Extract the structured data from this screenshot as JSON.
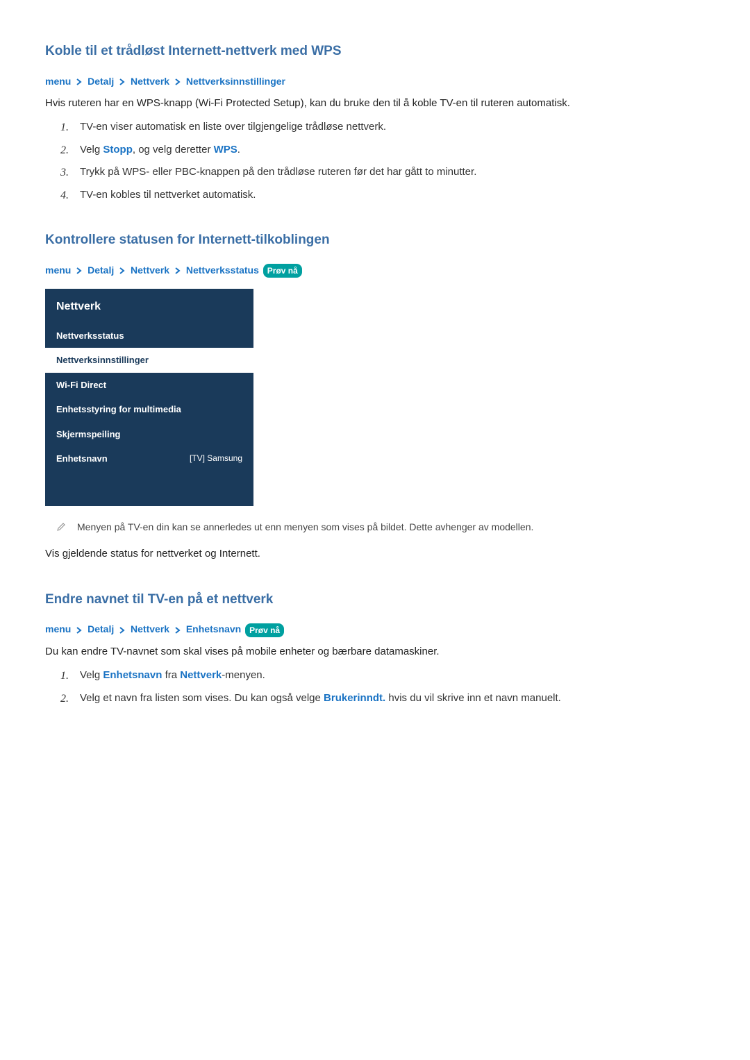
{
  "section1": {
    "heading": "Koble til et trådløst Internett-nettverk med WPS",
    "breadcrumb": [
      "menu",
      "Detalj",
      "Nettverk",
      "Nettverksinnstillinger"
    ],
    "intro": "Hvis ruteren har en WPS-knapp (Wi-Fi Protected Setup), kan du bruke den til å koble TV-en til ruteren automatisk.",
    "steps": {
      "s1": "TV-en viser automatisk en liste over tilgjengelige trådløse nettverk.",
      "s2_a": "Velg ",
      "s2_stop": "Stopp",
      "s2_b": ", og velg deretter ",
      "s2_wps": "WPS",
      "s2_c": ".",
      "s3": "Trykk på WPS- eller PBC-knappen på den trådløse ruteren før det har gått to minutter.",
      "s4": "TV-en kobles til nettverket automatisk."
    }
  },
  "section2": {
    "heading": "Kontrollere statusen for Internett-tilkoblingen",
    "breadcrumb": [
      "menu",
      "Detalj",
      "Nettverk",
      "Nettverksstatus"
    ],
    "try_now": "Prøv nå",
    "menu": {
      "title": "Nettverk",
      "items": {
        "i0": "Nettverksstatus",
        "i1": "Nettverksinnstillinger",
        "i2": "Wi-Fi Direct",
        "i3": "Enhetsstyring for multimedia",
        "i4": "Skjermspeiling",
        "i5": "Enhetsnavn",
        "i5_val": "[TV] Samsung"
      }
    },
    "note": "Menyen på TV-en din kan se annerledes ut enn menyen som vises på bildet. Dette avhenger av modellen.",
    "body": "Vis gjeldende status for nettverket og Internett."
  },
  "section3": {
    "heading": "Endre navnet til TV-en på et nettverk",
    "breadcrumb": [
      "menu",
      "Detalj",
      "Nettverk",
      "Enhetsnavn"
    ],
    "try_now": "Prøv nå",
    "intro": "Du kan endre TV-navnet som skal vises på mobile enheter og bærbare datamaskiner.",
    "steps": {
      "s1_a": "Velg ",
      "s1_link1": "Enhetsnavn",
      "s1_b": " fra ",
      "s1_link2": "Nettverk",
      "s1_c": "-menyen.",
      "s2_a": "Velg et navn fra listen som vises. Du kan også velge ",
      "s2_link": "Brukerinndt.",
      "s2_b": " hvis du vil skrive inn et navn manuelt."
    }
  },
  "nums": {
    "n1": "1.",
    "n2": "2.",
    "n3": "3.",
    "n4": "4."
  }
}
